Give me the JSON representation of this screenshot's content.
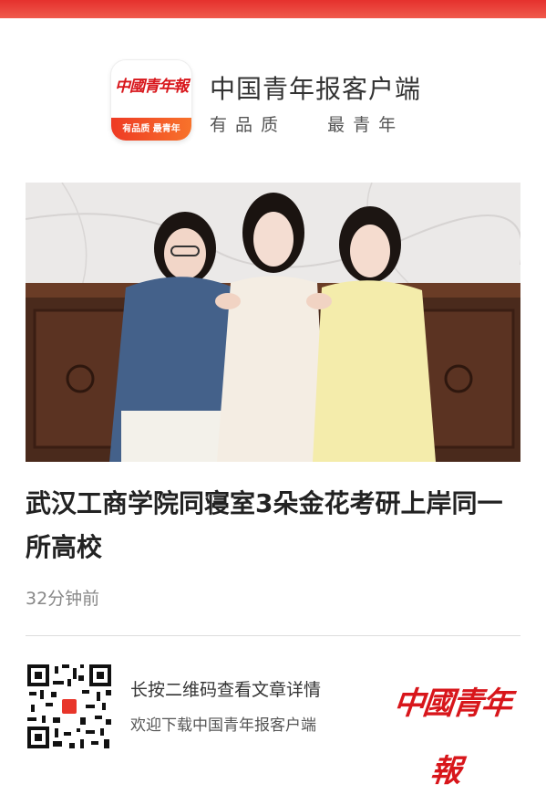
{
  "header": {
    "app_name": "中国青年报客户端",
    "slogan": "有品质   最青年",
    "logo_text": "中國青年報",
    "logo_tag": "有品质 最青年"
  },
  "article": {
    "image_alt": "三位女生在室内比心合影",
    "headline": "武汉工商学院同寝室3朵金花考研上岸同一所高校",
    "time": "32分钟前"
  },
  "footer": {
    "line1": "长按二维码查看文章详情",
    "line2": "欢迎下载中国青年报客户端",
    "logo_text": "中國青年報"
  },
  "colors": {
    "brand_red": "#d8161b",
    "top_bar": "#e5312d"
  }
}
